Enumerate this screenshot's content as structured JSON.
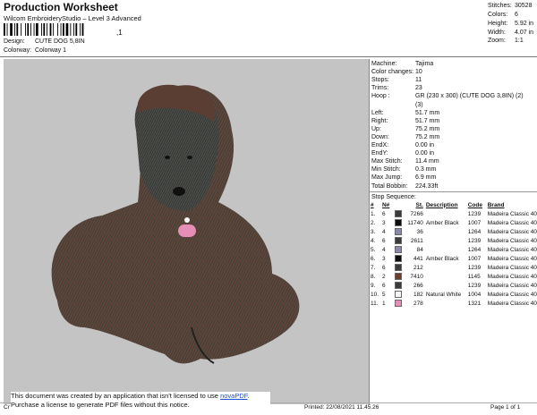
{
  "header": {
    "title": "Production Worksheet",
    "app": "Wilcom EmbroideryStudio – Level 3 Advanced",
    "barcode_suffix": ",1",
    "design_label": "Design:",
    "design_value": "CUTE DOG 5,8IN",
    "colorway_label": "Colorway:",
    "colorway_value": "Colorway 1"
  },
  "summary": {
    "stitches_label": "Stitches:",
    "stitches": "30528",
    "colors_label": "Colors:",
    "colors": "6",
    "height_label": "Height:",
    "height": "5.92 in",
    "width_label": "Width:",
    "width": "4.07 in",
    "zoom_label": "Zoom:",
    "zoom": "1:1"
  },
  "info": [
    {
      "label": "Machine:",
      "value": "Tajima"
    },
    {
      "label": "Color changes:",
      "value": "10"
    },
    {
      "label": "Stops:",
      "value": "11"
    },
    {
      "label": "Trims:",
      "value": "23"
    },
    {
      "label": "Hoop :",
      "value": "GR (230 x 300) (CUTE DOG 3,8IN) (2)"
    },
    {
      "label": "",
      "value": "(3)"
    },
    {
      "label": "Left:",
      "value": "51.7 mm"
    },
    {
      "label": "Right:",
      "value": "51.7 mm"
    },
    {
      "label": "Up:",
      "value": "75.2 mm"
    },
    {
      "label": "Down:",
      "value": "75.2 mm"
    },
    {
      "label": "EndX:",
      "value": "0.00 in"
    },
    {
      "label": "EndY:",
      "value": "0.00 in"
    },
    {
      "label": "Max Stitch:",
      "value": "11.4 mm"
    },
    {
      "label": "Min Stitch:",
      "value": "0.3 mm"
    },
    {
      "label": "Max Jump:",
      "value": "6.9 mm"
    },
    {
      "label": "Total Bobbin:",
      "value": "224.33ft"
    }
  ],
  "stop_sequence": {
    "heading": "Stop Sequence:",
    "columns": [
      "#",
      "N#",
      "",
      "St.",
      "Description",
      "Code",
      "Brand"
    ],
    "rows": [
      {
        "n": "1.",
        "needle": "6",
        "color": "#3b3b3b",
        "st": "7266",
        "desc": "",
        "code": "1239",
        "brand": "Madeira Classic 40"
      },
      {
        "n": "2.",
        "needle": "3",
        "color": "#0e0e0e",
        "st": "11740",
        "desc": "Amber Black",
        "code": "1007",
        "brand": "Madeira Classic 40"
      },
      {
        "n": "3.",
        "needle": "4",
        "color": "#8a8aa8",
        "st": "36",
        "desc": "",
        "code": "1264",
        "brand": "Madeira Classic 40"
      },
      {
        "n": "4.",
        "needle": "6",
        "color": "#3b3b3b",
        "st": "2611",
        "desc": "",
        "code": "1239",
        "brand": "Madeira Classic 40"
      },
      {
        "n": "5.",
        "needle": "4",
        "color": "#8a8aa8",
        "st": "84",
        "desc": "",
        "code": "1264",
        "brand": "Madeira Classic 40"
      },
      {
        "n": "6.",
        "needle": "3",
        "color": "#0e0e0e",
        "st": "441",
        "desc": "Amber Black",
        "code": "1007",
        "brand": "Madeira Classic 40"
      },
      {
        "n": "7.",
        "needle": "6",
        "color": "#3b3b3b",
        "st": "212",
        "desc": "",
        "code": "1239",
        "brand": "Madeira Classic 40"
      },
      {
        "n": "8.",
        "needle": "2",
        "color": "#6b3f2c",
        "st": "7410",
        "desc": "",
        "code": "1145",
        "brand": "Madeira Classic 40"
      },
      {
        "n": "9.",
        "needle": "6",
        "color": "#3b3b3b",
        "st": "266",
        "desc": "",
        "code": "1239",
        "brand": "Madeira Classic 40"
      },
      {
        "n": "10.",
        "needle": "5",
        "color": "#f7f7f7",
        "st": "182",
        "desc": "Natural White",
        "code": "1004",
        "brand": "Madeira Classic 40"
      },
      {
        "n": "11.",
        "needle": "1",
        "color": "#e58fb7",
        "st": "278",
        "desc": "",
        "code": "1321",
        "brand": "Madeira Classic 40"
      }
    ]
  },
  "notice": {
    "line1_text": "This document was created by an application that isn't licensed to use",
    "line1_link": "novaPDF",
    "line1_end": ".",
    "line2": "Purchase a license to generate PDF files without this notice."
  },
  "footer": {
    "left": "Cr",
    "printed": "Printed: 22/08/2021 11.45.26",
    "page": "Page 1 of 1"
  },
  "colors": {
    "canvas_bg": "#c4c4c4"
  }
}
